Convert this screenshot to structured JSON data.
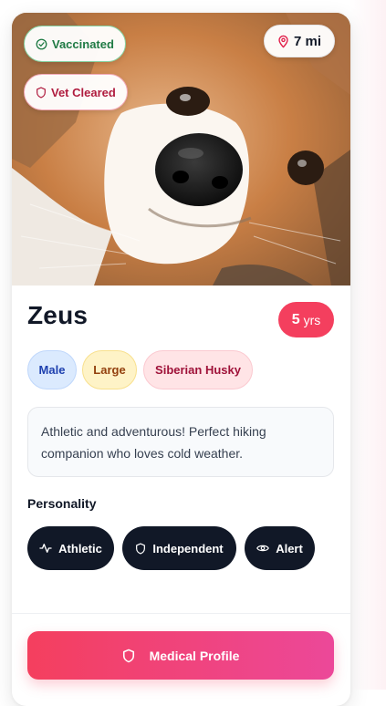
{
  "badges": {
    "vaccinated": "Vaccinated",
    "vet_cleared": "Vet Cleared",
    "distance": "7 mi"
  },
  "pet": {
    "name": "Zeus",
    "age_value": "5",
    "age_unit": "yrs",
    "tags": [
      "Male",
      "Large",
      "Siberian Husky"
    ],
    "description": "Athletic and adventurous! Perfect hiking companion who loves cold weather."
  },
  "personality": {
    "title": "Personality",
    "traits": [
      {
        "label": "Athletic",
        "icon": "activity-icon"
      },
      {
        "label": "Independent",
        "icon": "shield-icon"
      },
      {
        "label": "Alert",
        "icon": "eye-icon"
      }
    ]
  },
  "actions": {
    "medical_profile": "Medical Profile"
  },
  "colors": {
    "accent": "#f43f5e",
    "accent_end": "#ec4899",
    "trait_bg": "#111827",
    "vaccinated": "#1f7a44",
    "vet": "#b01c3f"
  }
}
